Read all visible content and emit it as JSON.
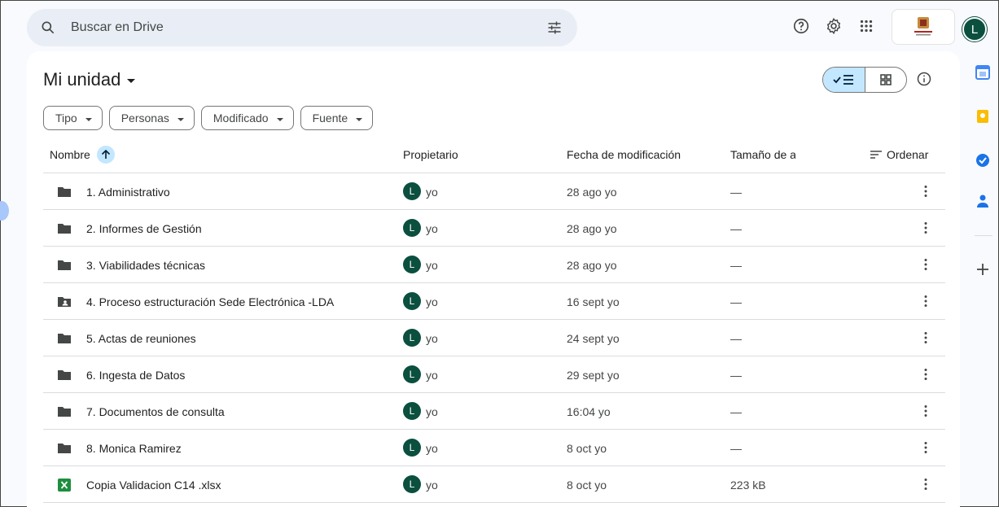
{
  "search": {
    "placeholder": "Buscar en Drive"
  },
  "topbar": {
    "help_icon": "help-icon",
    "settings_icon": "gear-icon",
    "apps_icon": "apps-grid-icon",
    "avatar_letter": "L"
  },
  "main": {
    "title": "Mi unidad",
    "filters": [
      {
        "label": "Tipo"
      },
      {
        "label": "Personas"
      },
      {
        "label": "Modificado"
      },
      {
        "label": "Fuente"
      }
    ],
    "columns": {
      "name": "Nombre",
      "owner": "Propietario",
      "modified": "Fecha de modificación",
      "size": "Tamaño de a",
      "sort": "Ordenar"
    },
    "rows": [
      {
        "type": "folder",
        "name": "1. Administrativo",
        "owner_initial": "L",
        "owner": "yo",
        "modified": "28 ago yo",
        "size": "—"
      },
      {
        "type": "folder",
        "name": "2. Informes de Gestión",
        "owner_initial": "L",
        "owner": "yo",
        "modified": "28 ago yo",
        "size": "—"
      },
      {
        "type": "folder",
        "name": "3. Viabilidades técnicas",
        "owner_initial": "L",
        "owner": "yo",
        "modified": "28 ago yo",
        "size": "—"
      },
      {
        "type": "shared-folder",
        "name": "4. Proceso estructuración Sede Electrónica -LDA",
        "owner_initial": "L",
        "owner": "yo",
        "modified": "16 sept yo",
        "size": "—"
      },
      {
        "type": "folder",
        "name": "5. Actas de reuniones",
        "owner_initial": "L",
        "owner": "yo",
        "modified": "24 sept yo",
        "size": "—"
      },
      {
        "type": "folder",
        "name": "6. Ingesta de Datos",
        "owner_initial": "L",
        "owner": "yo",
        "modified": "29 sept yo",
        "size": "—"
      },
      {
        "type": "folder",
        "name": "7. Documentos de consulta",
        "owner_initial": "L",
        "owner": "yo",
        "modified": "16:04 yo",
        "size": "—"
      },
      {
        "type": "folder",
        "name": "8. Monica Ramirez",
        "owner_initial": "L",
        "owner": "yo",
        "modified": "8 oct yo",
        "size": "—"
      },
      {
        "type": "sheet",
        "name": "Copia Validacion C14 .xlsx",
        "owner_initial": "L",
        "owner": "yo",
        "modified": "8 oct yo",
        "size": "223 kB"
      }
    ]
  },
  "side_rail": {
    "items": [
      "calendar-icon",
      "keep-icon",
      "tasks-icon",
      "contacts-icon",
      "add-icon"
    ],
    "colors": {
      "calendar": "#4285f4",
      "keep": "#fbbc04",
      "tasks": "#1a73e8",
      "contacts": "#1a73e8"
    }
  }
}
